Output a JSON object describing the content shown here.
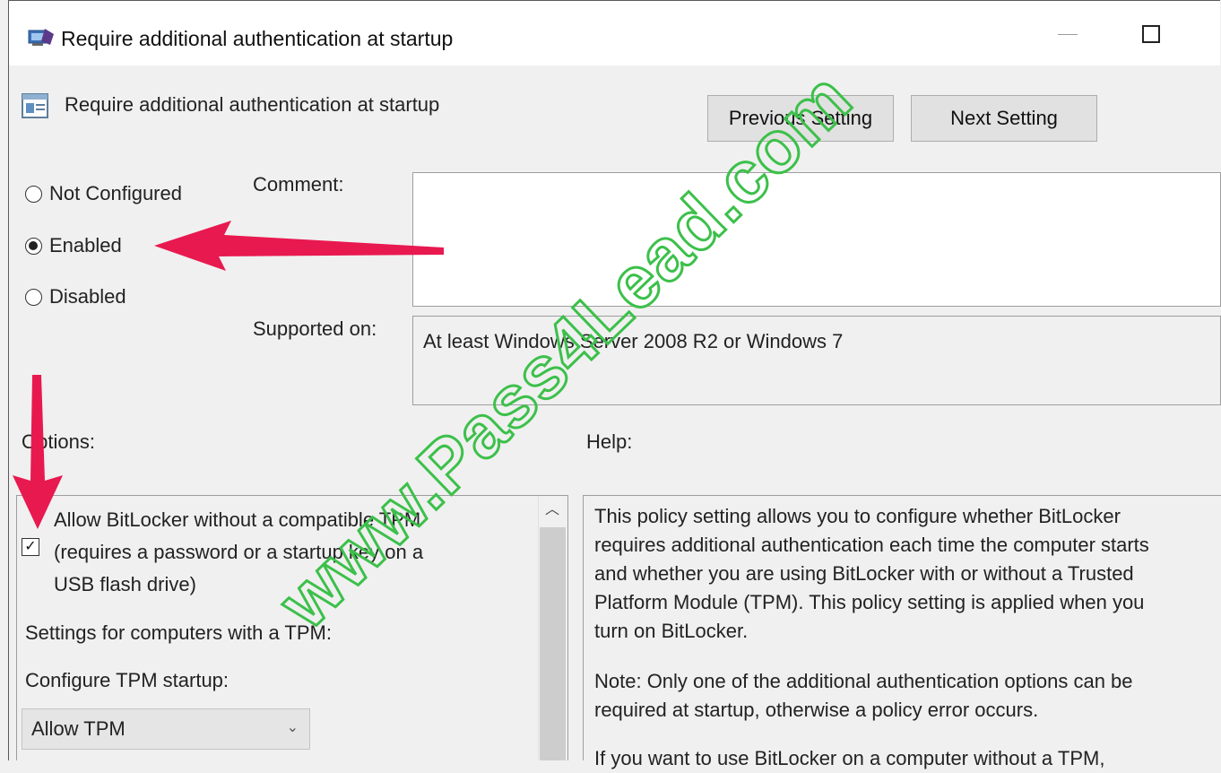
{
  "window": {
    "title": "Require additional authentication at startup"
  },
  "header": {
    "policy_title": "Require additional authentication at startup",
    "previous_label": "Previous Setting",
    "next_label": "Next Setting"
  },
  "state": {
    "options": [
      {
        "label": "Not Configured",
        "checked": false
      },
      {
        "label": "Enabled",
        "checked": true
      },
      {
        "label": "Disabled",
        "checked": false
      }
    ]
  },
  "fields": {
    "comment_label": "Comment:",
    "comment_value": "",
    "supported_label": "Supported on:",
    "supported_value": "At least Windows Server 2008 R2 or Windows 7"
  },
  "sections": {
    "options_label": "Options:",
    "help_label": "Help:"
  },
  "options_panel": {
    "allow_bitlocker_label": "Allow BitLocker without a compatible TPM\n(requires a password or a startup key on a\nUSB flash drive)",
    "allow_bitlocker_checked": true,
    "tpm_settings_label": "Settings for computers with a TPM:",
    "configure_tpm_label": "Configure TPM startup:",
    "configure_tpm_value": "Allow TPM"
  },
  "help_panel": {
    "paragraph1": "This policy setting allows you to configure whether BitLocker\nrequires additional authentication each time the computer starts\nand whether you are using BitLocker with or without a Trusted\nPlatform Module (TPM). This policy setting is applied when you\nturn on BitLocker.",
    "paragraph2": "Note: Only one of the additional authentication options can be\nrequired at startup, otherwise a policy error occurs.",
    "paragraph3": "If you want to use BitLocker on a computer without a TPM,"
  },
  "watermark": {
    "text": "www.Pass4Lead.com",
    "color": "#3cc04a"
  },
  "annotation": {
    "arrow_color": "#e8194f"
  }
}
